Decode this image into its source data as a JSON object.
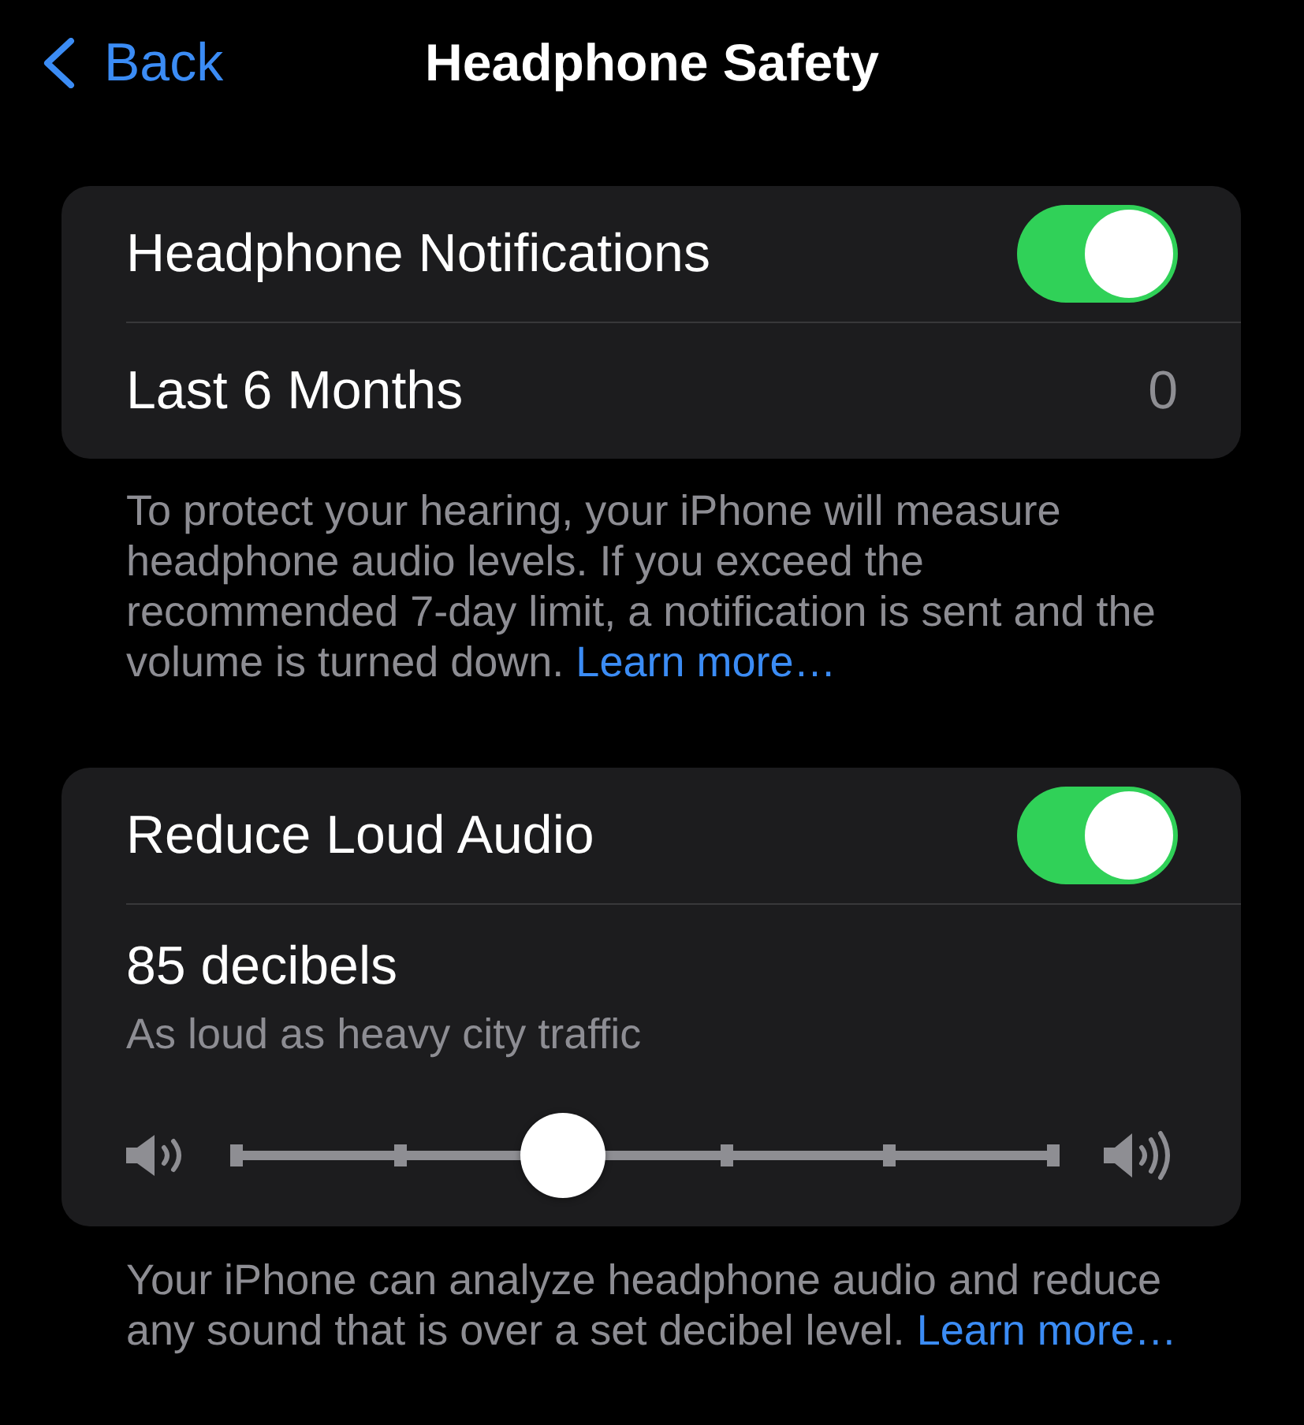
{
  "nav": {
    "back": {
      "label": "Back"
    },
    "title": "Headphone Safety"
  },
  "sections": [
    {
      "rows": [
        {
          "kind": "toggle",
          "label": "Headphone Notifications",
          "on": true
        },
        {
          "kind": "value",
          "label": "Last 6 Months",
          "value": "0"
        }
      ],
      "footer": {
        "text": "To protect your hearing, your iPhone will measure headphone audio levels. If you exceed the recommended 7-day limit, a notification is sent and the volume is turned down.",
        "link": "Learn more…"
      }
    },
    {
      "rows": [
        {
          "kind": "toggle",
          "label": "Reduce Loud Audio",
          "on": true
        },
        {
          "kind": "slider",
          "title": "85 decibels",
          "subtitle": "As loud as heavy city traffic",
          "level": 0.4
        }
      ],
      "footer": {
        "text": "Your iPhone can analyze headphone audio and reduce any sound that is over a set decibel level.",
        "link": "Learn more…"
      }
    }
  ]
}
